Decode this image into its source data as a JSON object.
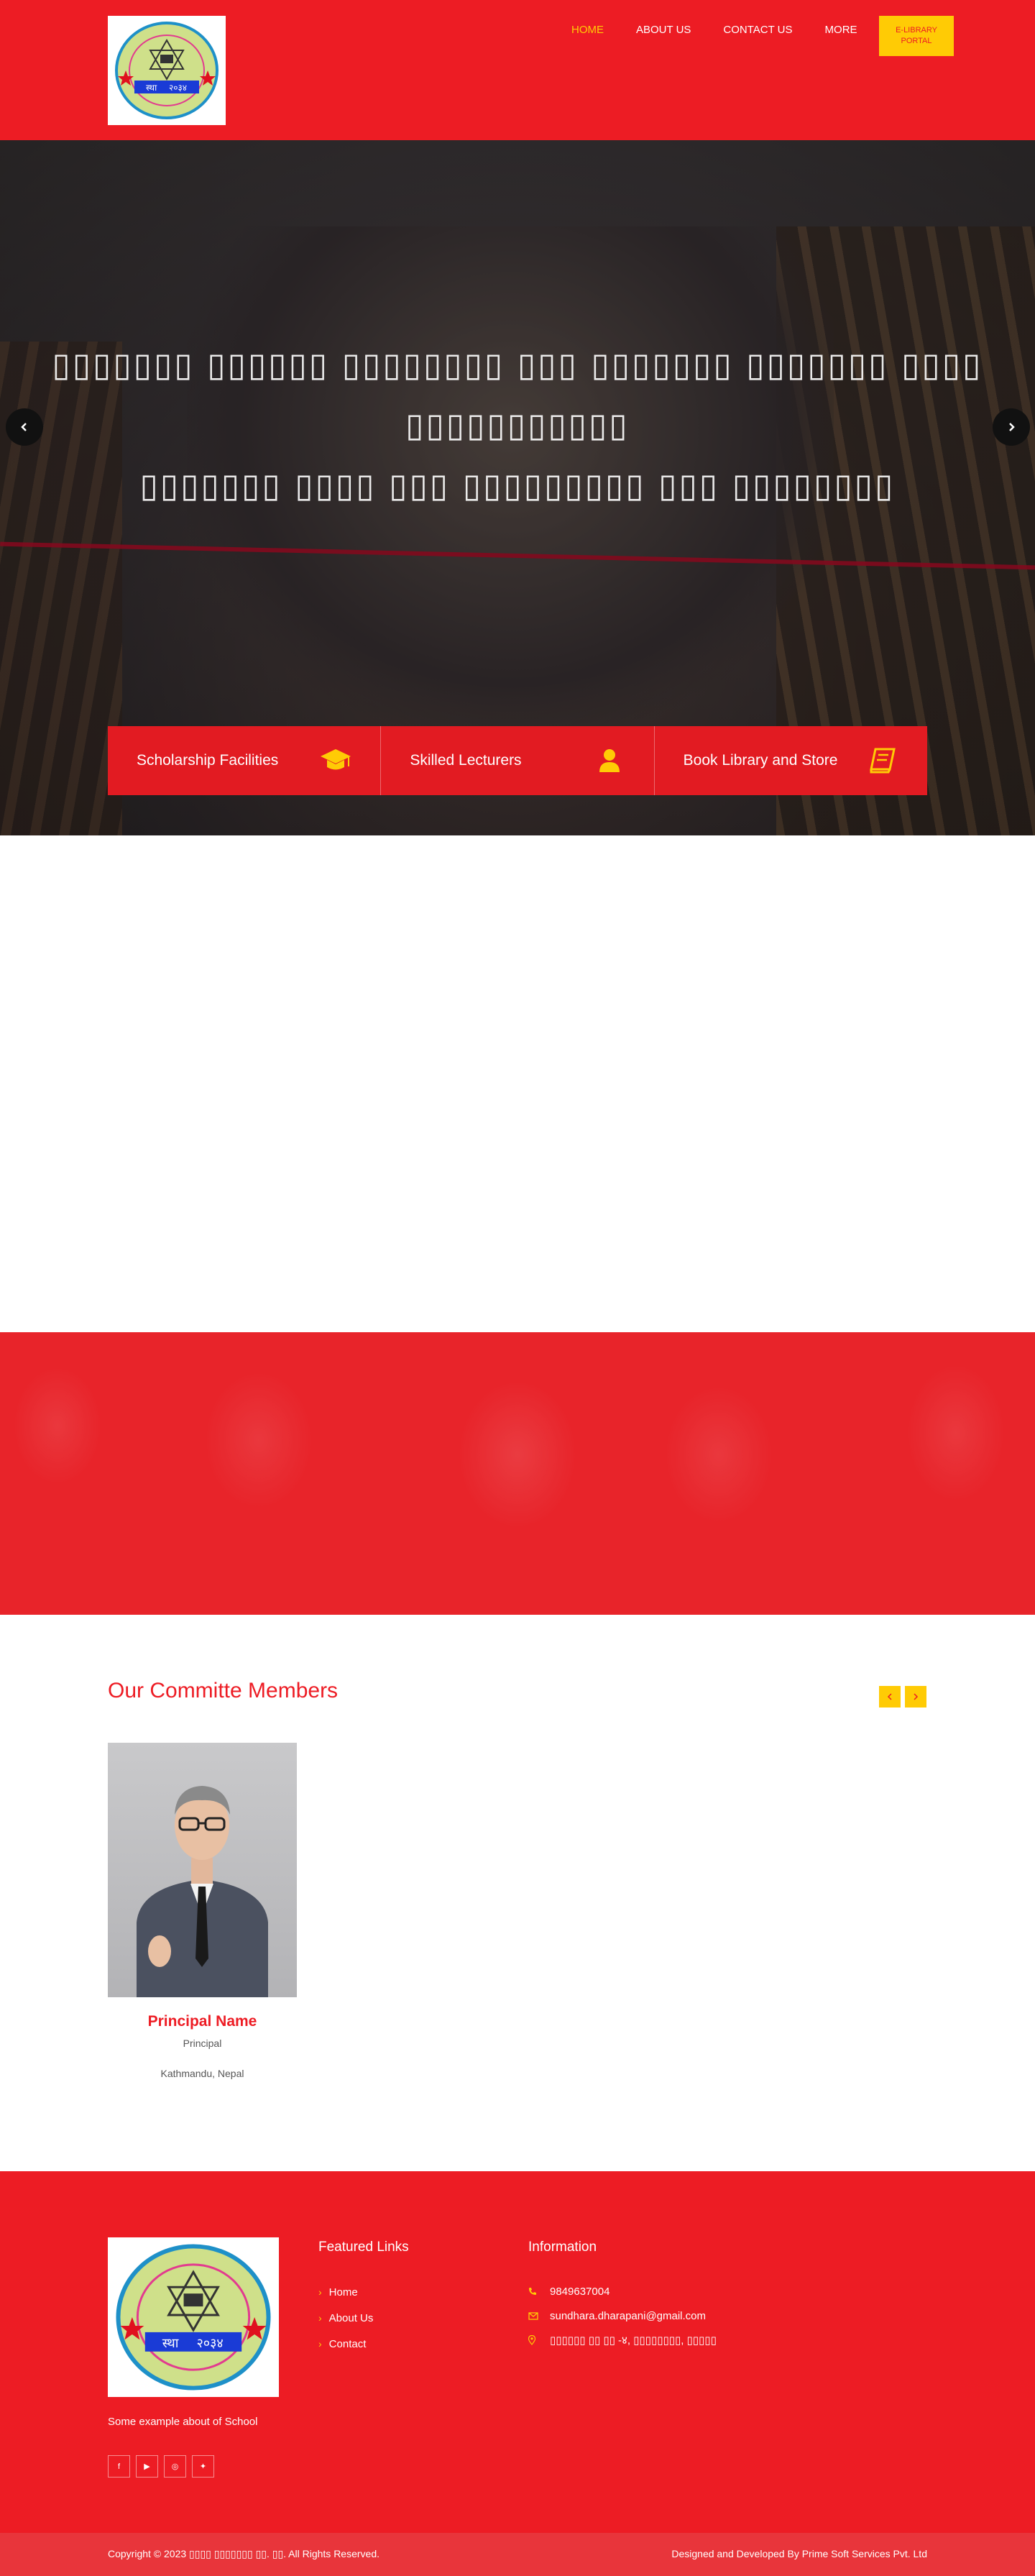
{
  "header": {
    "nav": [
      {
        "label": "HOME",
        "active": true
      },
      {
        "label": "ABOUT US",
        "active": false
      },
      {
        "label": "CONTACT US",
        "active": false
      },
      {
        "label": "MORE",
        "active": false
      }
    ],
    "elibrary_button": "E-LIBRARY PORTAL",
    "logo": {
      "top_text": "श्री सुन्धरा माध्यमिक विद्यालय",
      "est_label": "स्था",
      "est_year": "२०३४",
      "bottom_text": "काठमाडौँ, न.पा.-३, धारापानी, काठमाडौँ"
    }
  },
  "hero": {
    "title_line1": "▯▯▯▯▯▯▯ ▯▯▯▯▯▯ ▯▯▯▯▯▯▯▯ ▯▯▯ ▯▯▯▯▯▯▯ ▯▯▯▯▯▯▯ ▯▯▯▯ ▯▯▯▯▯▯▯▯▯▯▯",
    "title_line2": "▯▯▯▯▯▯▯ ▯▯▯▯ ▯▯▯ ▯▯▯▯▯▯▯▯▯ ▯▯▯ ▯▯▯▯▯▯▯▯",
    "features": [
      {
        "label": "Scholarship Facilities",
        "icon": "graduation-cap-icon"
      },
      {
        "label": "Skilled Lecturers",
        "icon": "user-icon"
      },
      {
        "label": "Book Library and Store",
        "icon": "book-icon"
      }
    ]
  },
  "committee": {
    "title": "Our Committe Members",
    "members": [
      {
        "name": "Principal Name",
        "role": "Principal",
        "location": "Kathmandu, Nepal"
      }
    ]
  },
  "footer": {
    "about": "Some example about of School",
    "social": [
      "facebook-icon",
      "youtube-icon",
      "instagram-icon",
      "twitter-icon"
    ],
    "featured_title": "Featured Links",
    "links": [
      "Home",
      "About Us",
      "Contact"
    ],
    "info_title": "Information",
    "phone": "9849637004",
    "email": "sundhara.dharapani@gmail.com",
    "address": "▯▯▯▯▯▯ ▯▯ ▯▯ -४, ▯▯▯▯▯▯▯▯, ▯▯▯▯▯",
    "copyright": "Copyright © 2023 ▯▯▯▯ ▯▯▯▯▯▯▯ ▯▯. ▯▯. All Rights Reserved.",
    "developer": "Designed and Developed By Prime Soft Services Pvt. Ltd"
  },
  "colors": {
    "primary_red": "#ed1c24",
    "accent_yellow": "#ffcb05"
  }
}
